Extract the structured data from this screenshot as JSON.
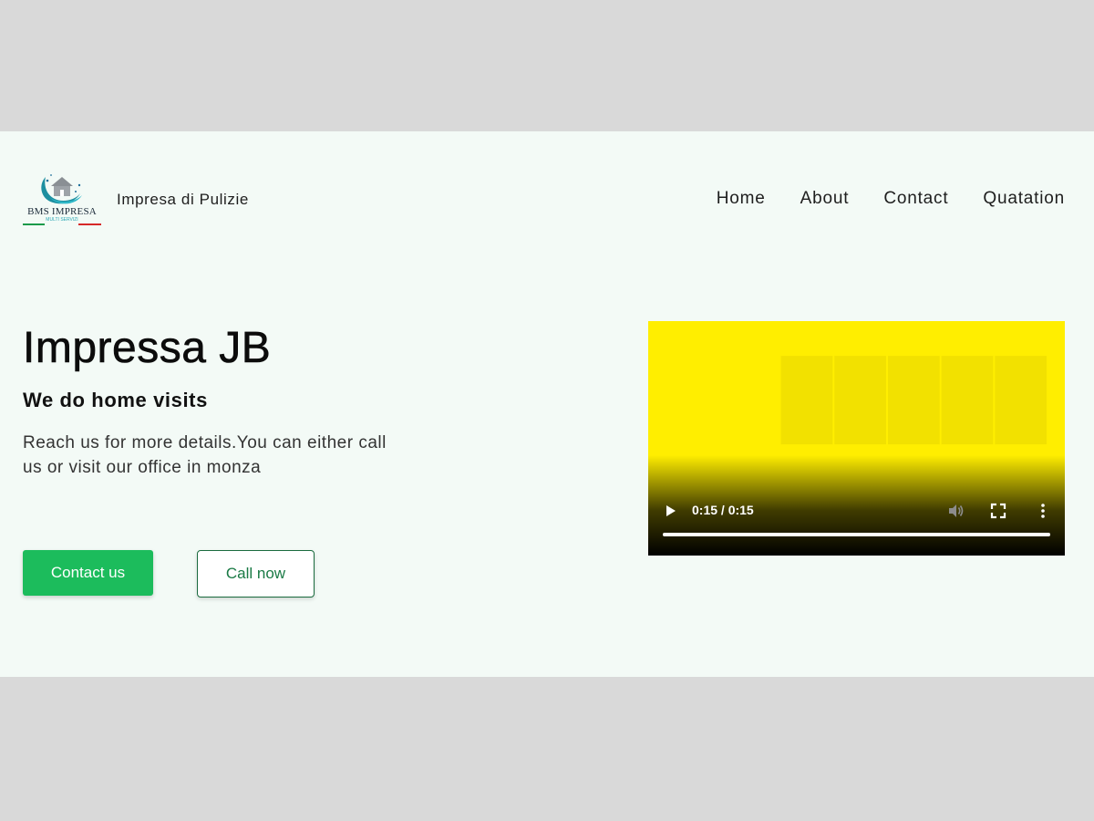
{
  "header": {
    "logo": {
      "text": "BMS IMPRESA",
      "subtext": "MULTI SERVIZI"
    },
    "brand_name": "Impresa di Pulizie",
    "nav": [
      {
        "label": "Home"
      },
      {
        "label": "About"
      },
      {
        "label": "Contact"
      },
      {
        "label": "Quatation"
      }
    ]
  },
  "hero": {
    "title": "Impressa JB",
    "subtitle": "We do home visits",
    "description": "Reach us for more details.You can either call us or visit our office in monza",
    "primary_button": "Contact us",
    "secondary_button": "Call now"
  },
  "video": {
    "time_display": "0:15 / 0:15",
    "progress": 1.0,
    "poster_color": "#ffee00",
    "icons": [
      "play-icon",
      "volume-icon",
      "fullscreen-icon",
      "more-options-icon"
    ]
  },
  "colors": {
    "primary_green": "#1cbc5c",
    "outline_green": "#1a6b3e",
    "page_background": "#f3faf6",
    "outer_background": "#d9d9d9"
  }
}
